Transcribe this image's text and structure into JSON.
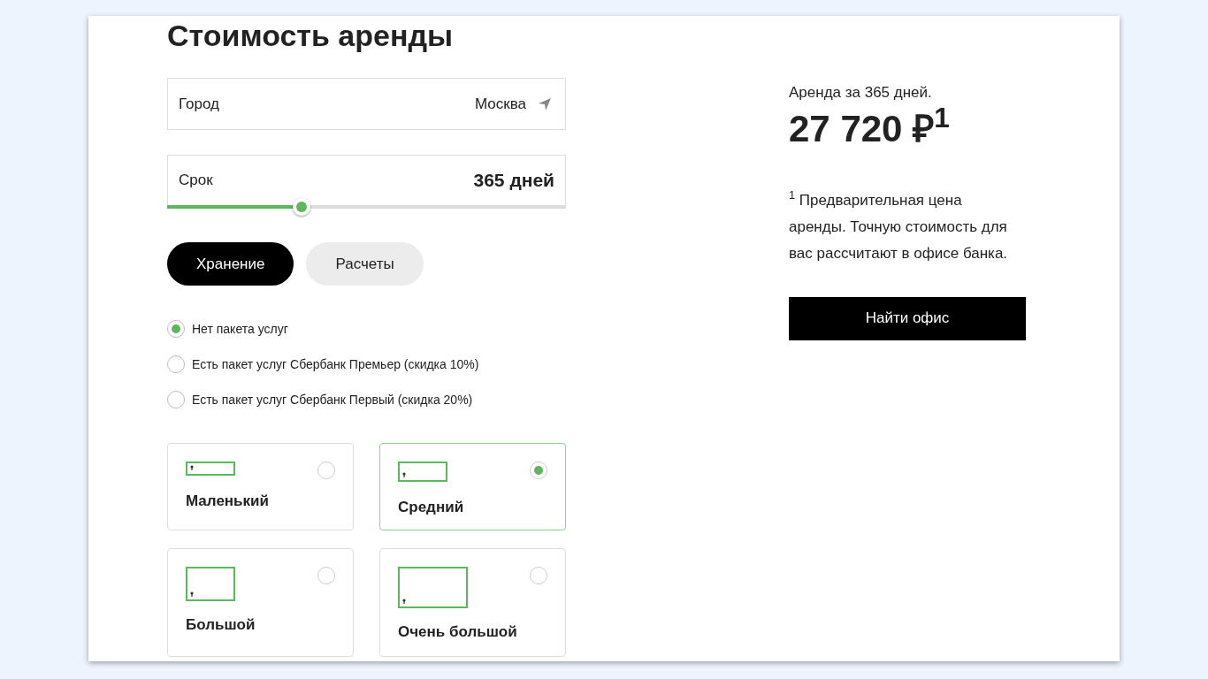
{
  "title": "Стоимость аренды",
  "city": {
    "label": "Город",
    "value": "Москва"
  },
  "term": {
    "label": "Срок",
    "value": "365 дней",
    "level": 0.337
  },
  "tabs": [
    {
      "label": "Хранение",
      "selected": true
    },
    {
      "label": "Расчеты",
      "selected": false
    }
  ],
  "packages": [
    {
      "label": "Нет пакета услуг",
      "selected": true
    },
    {
      "label": "Есть пакет услуг Сбербанк Премьер (скидка 10%)",
      "selected": false
    },
    {
      "label": "Есть пакет услуг Сбербанк Первый (скидка 20%)",
      "selected": false
    }
  ],
  "sizes": [
    {
      "kind": "small",
      "label": "Маленький",
      "selected": false
    },
    {
      "kind": "medium",
      "label": "Средний",
      "selected": true
    },
    {
      "kind": "large",
      "label": "Большой",
      "selected": false
    },
    {
      "kind": "xlarge",
      "label": "Очень большой",
      "selected": false
    }
  ],
  "summary": {
    "caption": "Аренда за 365 дней.",
    "price": "27 720 ₽$^{1}$",
    "footnote": "$^{1}$ Предварительная цена аренды. Точную стоимость для вас рассчитают в офисе банка.",
    "button": "Найти офис"
  }
}
